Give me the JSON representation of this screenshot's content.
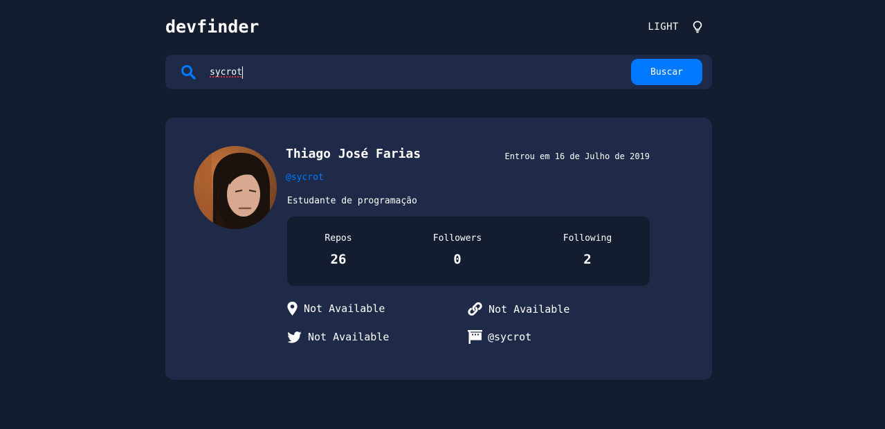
{
  "header": {
    "logo": "devfinder",
    "theme_label": "LIGHT",
    "theme_icon": "lightbulb-icon"
  },
  "search": {
    "icon": "search-icon",
    "value": "sycrot",
    "button_label": "Buscar"
  },
  "profile": {
    "name": "Thiago José Farias",
    "joined": "Entrou em 16 de Julho de 2019",
    "login": "@sycrot",
    "bio": "Estudante de programação",
    "stats": [
      {
        "label": "Repos",
        "value": "26"
      },
      {
        "label": "Followers",
        "value": "0"
      },
      {
        "label": "Following",
        "value": "2"
      }
    ],
    "links": {
      "location": {
        "icon": "location-pin-icon",
        "text": "Not Available"
      },
      "blog": {
        "icon": "link-icon",
        "text": "Not Available"
      },
      "twitter": {
        "icon": "twitter-icon",
        "text": "Not Available"
      },
      "company": {
        "icon": "building-icon",
        "text": "@sycrot"
      }
    }
  },
  "colors": {
    "background": "#141c2f",
    "card": "#1f2a48",
    "accent": "#0079ff",
    "text": "#ffffff"
  }
}
